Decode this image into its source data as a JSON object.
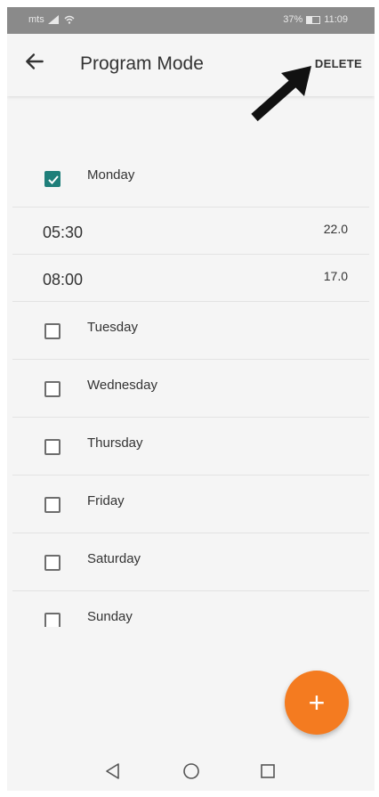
{
  "status_bar": {
    "carrier": "mts",
    "battery": "37%",
    "time": "11:09",
    "bar_color": "#8a8a8a"
  },
  "app_bar": {
    "title": "Program Mode",
    "back_icon": "arrow-left-icon",
    "delete_label": "DELETE"
  },
  "days": [
    {
      "label": "Monday",
      "checked": true,
      "entries": [
        {
          "time": "05:30",
          "temp": "22.0"
        },
        {
          "time": "08:00",
          "temp": "17.0"
        }
      ]
    },
    {
      "label": "Tuesday",
      "checked": false
    },
    {
      "label": "Wednesday",
      "checked": false
    },
    {
      "label": "Thursday",
      "checked": false
    },
    {
      "label": "Friday",
      "checked": false
    },
    {
      "label": "Saturday",
      "checked": false
    },
    {
      "label": "Sunday",
      "checked": false
    }
  ],
  "fab": {
    "label": "+",
    "icon": "plus-icon",
    "color": "#f47b20"
  },
  "nav_bar": {
    "icons": [
      "back-triangle-icon",
      "home-circle-icon",
      "recents-square-icon"
    ]
  },
  "colors": {
    "checkbox_checked": "#1f7f7a",
    "accent": "#f47b20"
  }
}
